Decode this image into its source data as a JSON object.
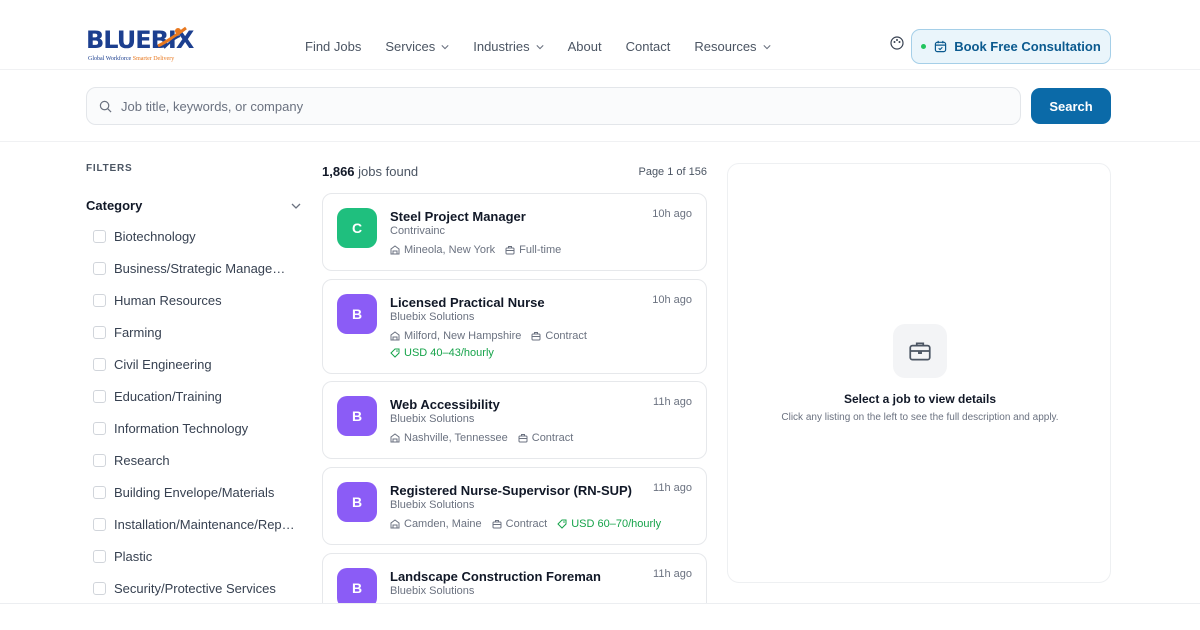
{
  "brand": {
    "name": "BLUEBIX",
    "tagline_main": "Global Workforce",
    "tagline_highlight": "Smarter Delivery",
    "colors": {
      "primary": "#1c3f8f",
      "accent": "#e8781f"
    }
  },
  "nav": {
    "items": [
      {
        "label": "Find Jobs",
        "dropdown": false
      },
      {
        "label": "Services",
        "dropdown": true
      },
      {
        "label": "Industries",
        "dropdown": true
      },
      {
        "label": "About",
        "dropdown": false
      },
      {
        "label": "Contact",
        "dropdown": false
      },
      {
        "label": "Resources",
        "dropdown": true
      }
    ],
    "theme_icon": "palette-icon",
    "cta_label": "Book Free Consultation",
    "cta_icon": "calendar-icon"
  },
  "search": {
    "placeholder": "Job title, keywords, or company",
    "value": "",
    "button_label": "Search",
    "icon": "search-icon"
  },
  "filters": {
    "title": "FILTERS",
    "category_heading": "Category",
    "categories": [
      "Biotechnology",
      "Business/Strategic Manageme...",
      "Human Resources",
      "Farming",
      "Civil Engineering",
      "Education/Training",
      "Information Technology",
      "Research",
      "Building Envelope/Materials",
      "Installation/Maintenance/Repair",
      "Plastic",
      "Security/Protective Services"
    ]
  },
  "results": {
    "count": "1,866",
    "count_suffix": "jobs found",
    "page_label": "Page 1 of 156"
  },
  "jobs": [
    {
      "initial": "C",
      "color": "#1fbf7e",
      "title": "Steel Project Manager",
      "company": "Contrivainc",
      "location": "Mineola, New York",
      "type": "Full-time",
      "salary": "",
      "time": "10h ago",
      "salary_inline": false
    },
    {
      "initial": "B",
      "color": "#8b5cf6",
      "title": "Licensed Practical Nurse",
      "company": "Bluebix Solutions",
      "location": "Milford, New Hampshire",
      "type": "Contract",
      "salary": "USD 40–43/hourly",
      "time": "10h ago",
      "salary_inline": false
    },
    {
      "initial": "B",
      "color": "#8b5cf6",
      "title": "Web Accessibility",
      "company": "Bluebix Solutions",
      "location": "Nashville, Tennessee",
      "type": "Contract",
      "salary": "",
      "time": "11h ago",
      "salary_inline": false
    },
    {
      "initial": "B",
      "color": "#8b5cf6",
      "title": "Registered Nurse-Supervisor (RN-SUP)",
      "company": "Bluebix Solutions",
      "location": "Camden, Maine",
      "type": "Contract",
      "salary": "USD 60–70/hourly",
      "time": "11h ago",
      "salary_inline": true
    },
    {
      "initial": "B",
      "color": "#8b5cf6",
      "title": "Landscape Construction Foreman",
      "company": "Bluebix Solutions",
      "location": "",
      "type": "",
      "salary": "",
      "time": "11h ago",
      "salary_inline": false
    }
  ],
  "detail": {
    "icon": "briefcase-icon",
    "title": "Select a job to view details",
    "subtitle": "Click any listing on the left to see the full description and apply."
  }
}
